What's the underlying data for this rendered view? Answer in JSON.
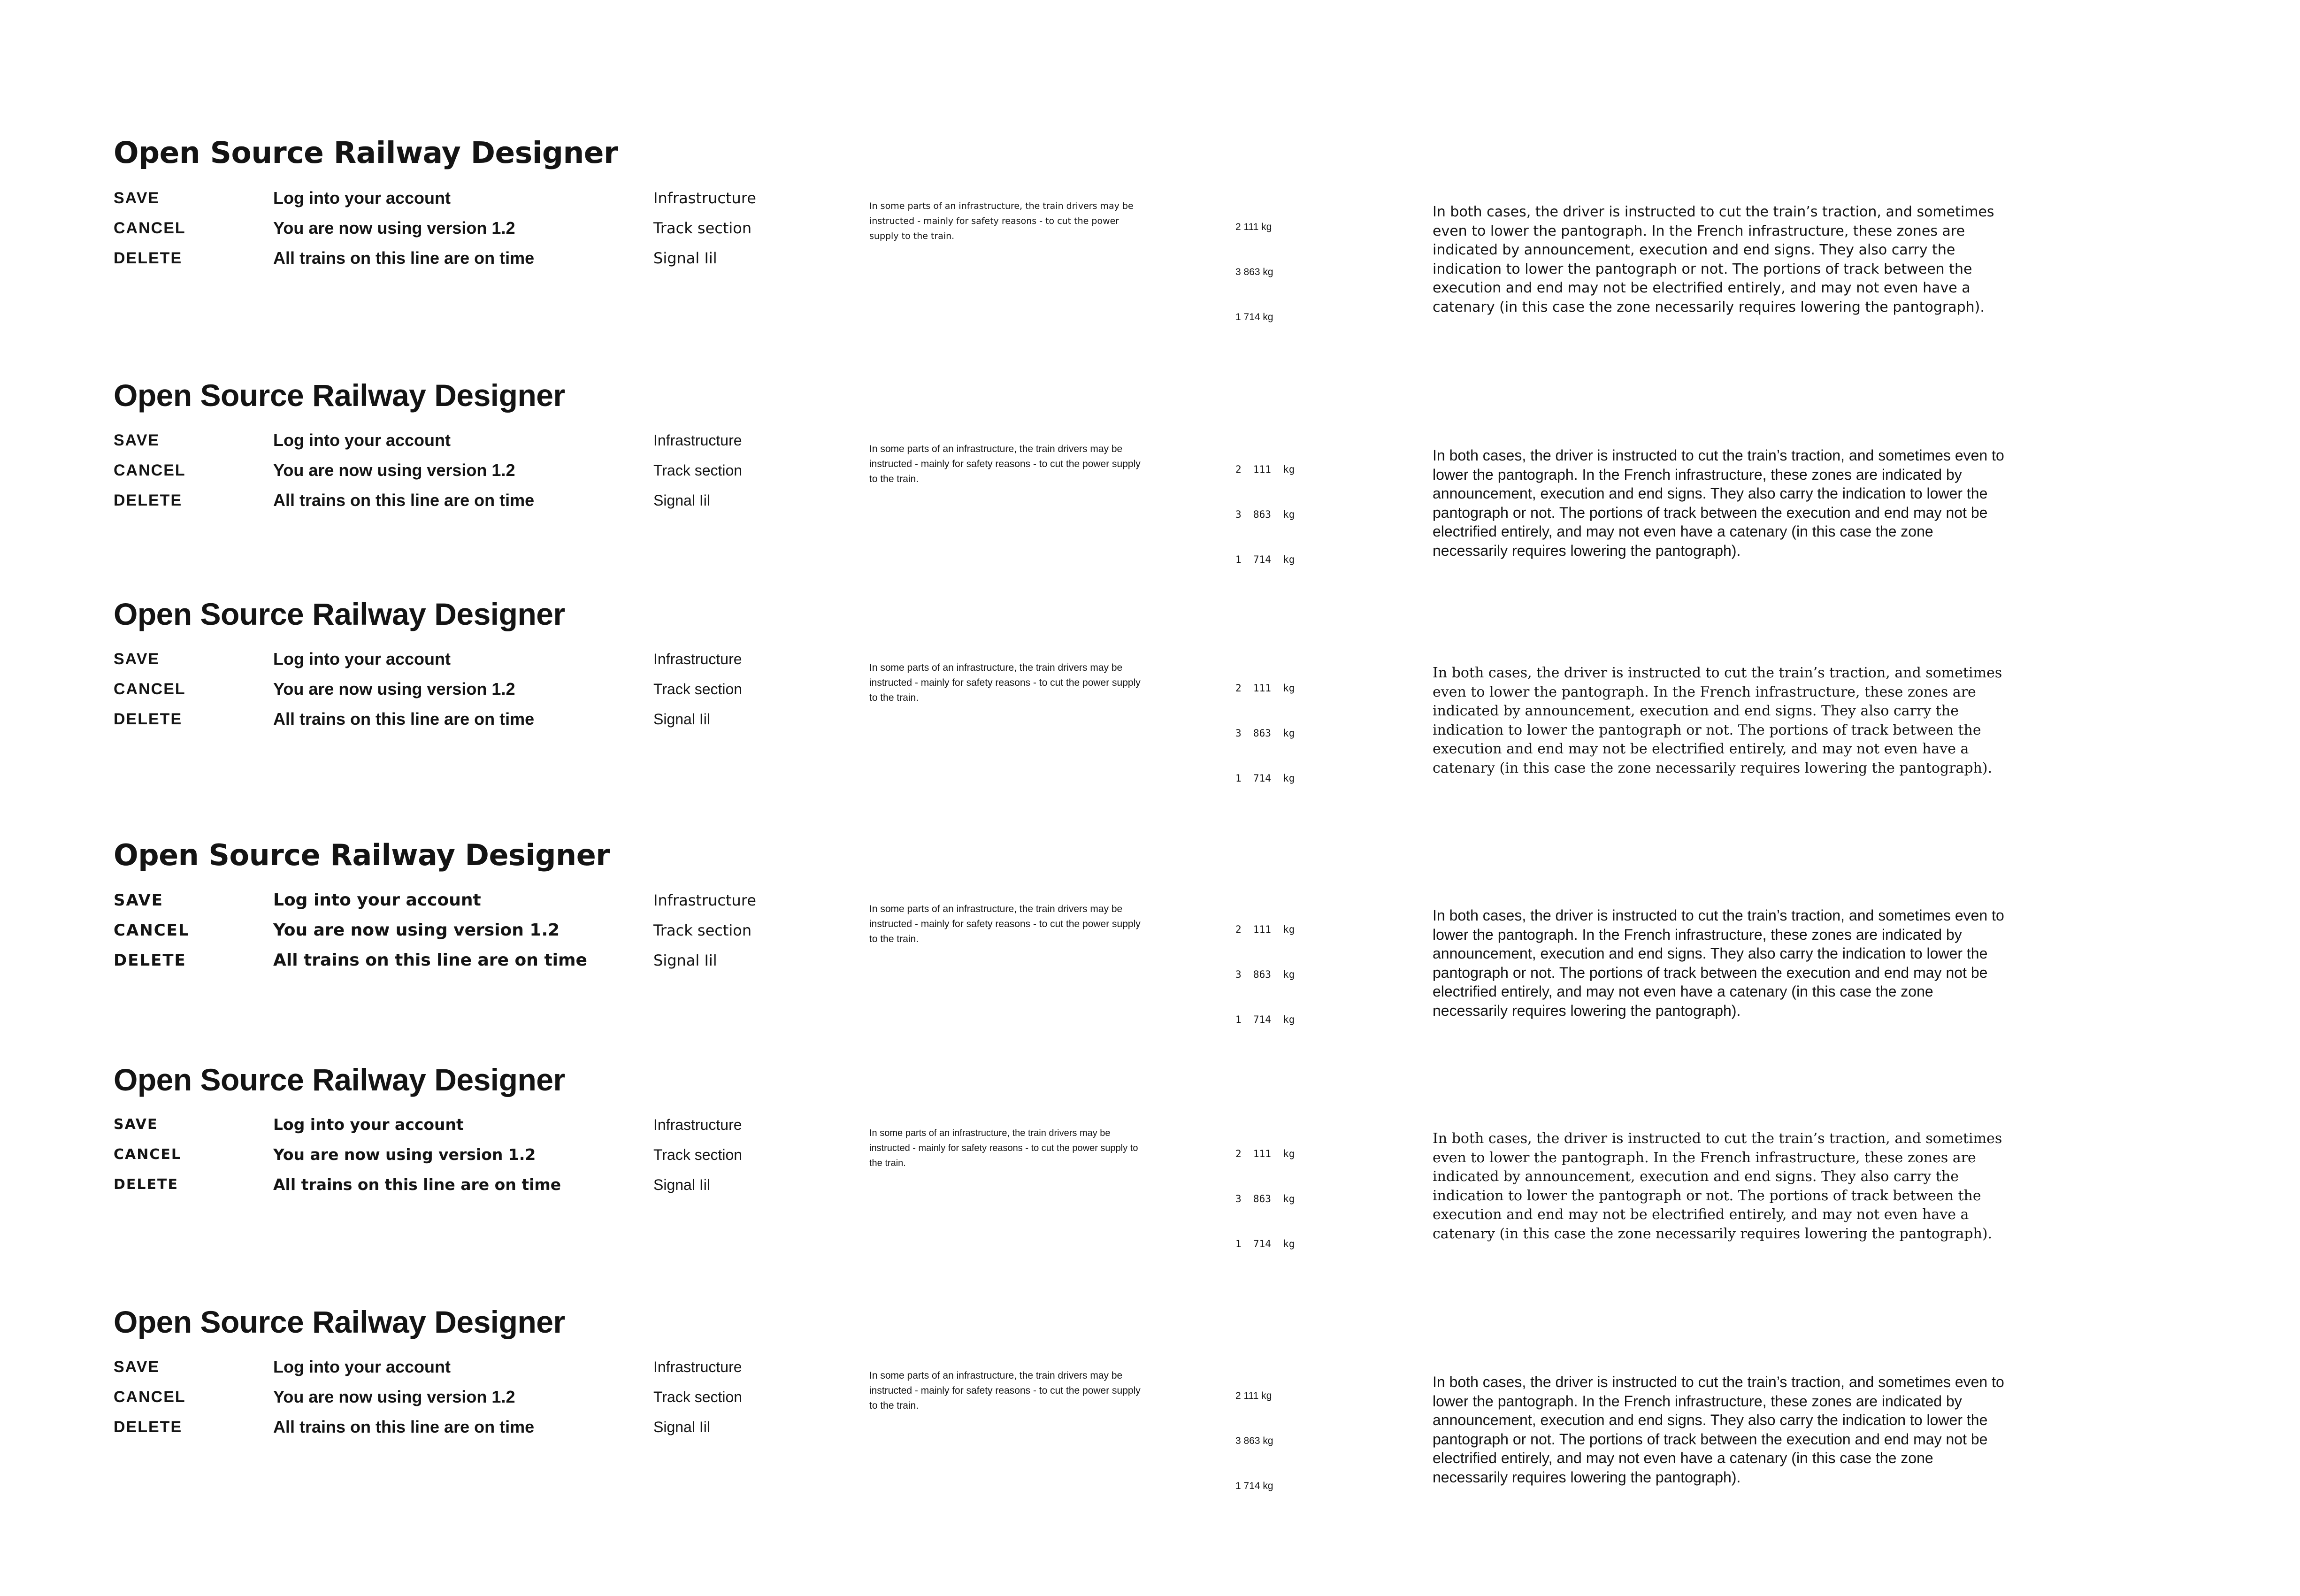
{
  "specimens": [
    {
      "title": "Open Source Railway Designer",
      "buttons": [
        "SAVE",
        "CANCEL",
        "DELETE"
      ],
      "messages": [
        "Log into your account",
        "You are now using version 1.2",
        "All trains on this line are on time"
      ],
      "menu": [
        "Infrastructure",
        "Track section",
        "Signal Iil"
      ],
      "small_text": "In some parts of an infrastructure, the train drivers may be instructed - mainly for safety reasons - to cut the power supply to the train.",
      "weights": [
        "2 111 kg",
        "3 863 kg",
        "1 714 kg"
      ],
      "body_text": "In both cases, the driver is instructed to cut the train’s traction, and sometimes even to lower the pantograph. In the French infrastructure, these zones are indicated by announcement, execution and end signs. They also carry the indication to lower the pantograph or not. The portions of track between the execution and end may not be electrified entirely, and may not even have a catenary (in this case the zone necessarily requires lowering the pantograph)."
    },
    {
      "title": "Open Source Railway Designer",
      "buttons": [
        "SAVE",
        "CANCEL",
        "DELETE"
      ],
      "messages": [
        "Log into your account",
        "You are now using version 1.2",
        "All trains on this line are on time"
      ],
      "menu": [
        "Infrastructure",
        "Track section",
        "Signal Iil"
      ],
      "small_text": "In some parts of an infrastructure, the train drivers may be instructed - mainly for safety reasons - to cut the power supply to the train.",
      "weights": [
        "2  111  kg",
        "3  863  kg",
        "1  714  kg"
      ],
      "body_text": "In both cases, the driver is instructed to cut the train’s traction, and sometimes even to lower the pantograph. In the French infrastructure, these zones are indicated by announcement, execution and end signs. They also carry the indication to lower the pantograph or not. The portions of track between the execution and end may not be electrified entirely, and may not even have a catenary (in this case the zone necessarily requires lowering the pantograph)."
    },
    {
      "title": "Open Source Railway Designer",
      "buttons": [
        "SAVE",
        "CANCEL",
        "DELETE"
      ],
      "messages": [
        "Log into your account",
        "You are now using version 1.2",
        "All trains on this line are on time"
      ],
      "menu": [
        "Infrastructure",
        "Track section",
        "Signal Iil"
      ],
      "small_text": "In some parts of an infrastructure, the train drivers may be instructed - mainly for safety reasons - to cut the power supply to the train.",
      "weights": [
        "2  111  kg",
        "3  863  kg",
        "1  714  kg"
      ],
      "body_text": "In both cases, the driver is instructed to cut the train’s traction, and sometimes even to lower the pantograph. In the French infrastructure, these zones are indicated by announcement, execution and end signs. They also carry the indication to lower the pantograph or not. The portions of track between the execution and end may not be electrified entirely, and may not even have a catenary (in this case the zone necessarily requires lowering the pantograph)."
    },
    {
      "title": "Open Source Railway Designer",
      "buttons": [
        "SAVE",
        "CANCEL",
        "DELETE"
      ],
      "messages": [
        "Log into your account",
        "You are now using version 1.2",
        "All trains on this line are on time"
      ],
      "menu": [
        "Infrastructure",
        "Track section",
        "Signal Iil"
      ],
      "small_text": "In some parts of an infrastructure, the train drivers may be instructed - mainly for safety reasons - to cut the power supply to the train.",
      "weights": [
        "2  111  kg",
        "3  863  kg",
        "1  714  kg"
      ],
      "body_text": "In both cases, the driver is instructed to cut the train’s traction, and sometimes even to lower the pantograph. In the French infrastructure, these zones are indicated by announcement, execution and end signs. They also carry the indication to lower the pantograph or not. The portions of track between the execution and end may not be electrified entirely, and may not even have a catenary (in this case the zone necessarily requires lowering the pantograph)."
    },
    {
      "title": "Open Source Railway Designer",
      "buttons": [
        "SAVE",
        "CANCEL",
        "DELETE"
      ],
      "messages": [
        "Log into your account",
        "You are now using version 1.2",
        "All trains on this line are on time"
      ],
      "menu": [
        "Infrastructure",
        "Track section",
        "Signal Iil"
      ],
      "small_text": "In some parts of an infrastructure, the train drivers may be instructed - mainly for safety reasons - to cut the power supply to the train.",
      "weights": [
        "2  111  kg",
        "3  863  kg",
        "1  714  kg"
      ],
      "body_text": "In both cases, the driver is instructed to cut the train’s traction, and sometimes even to lower the pantograph. In the French infrastructure, these zones are indicated by announcement, execution and end signs. They also carry the indication to lower the pantograph or not. The portions of track between the execution and end may not be electrified entirely, and may not even have a catenary (in this case the zone necessarily requires lowering the pantograph)."
    },
    {
      "title": "Open Source Railway Designer",
      "buttons": [
        "SAVE",
        "CANCEL",
        "DELETE"
      ],
      "messages": [
        "Log into your account",
        "You are now using version 1.2",
        "All trains on this line are on time"
      ],
      "menu": [
        "Infrastructure",
        "Track section",
        "Signal Iil"
      ],
      "small_text": "In some parts of an infrastructure, the train drivers may be instructed - mainly for safety reasons - to cut the power supply to the train.",
      "weights": [
        "2 111 kg",
        "3 863 kg",
        "1 714 kg"
      ],
      "body_text": "In both cases, the driver is instructed to cut the train’s traction, and sometimes even to lower the pantograph. In the French infrastructure, these zones are indicated by announcement, execution and end signs. They also carry the indication to lower the pantograph or not. The portions of track between the execution and end may not be electrified entirely, and may not even have a catenary (in this case the zone necessarily requires lowering the pantograph)."
    }
  ]
}
